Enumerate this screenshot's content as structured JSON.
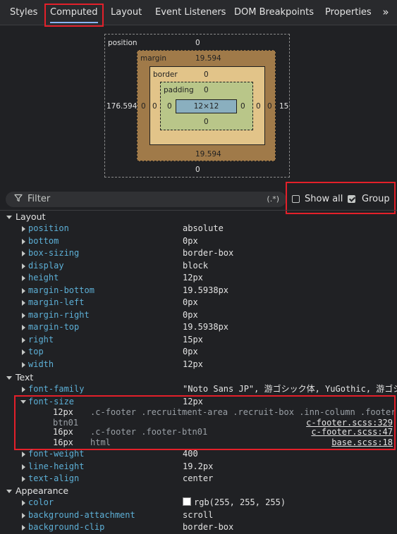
{
  "tabs": [
    {
      "label": "Styles"
    },
    {
      "label": "Computed"
    },
    {
      "label": "Layout"
    },
    {
      "label": "Event Listeners"
    },
    {
      "label": "DOM Breakpoints"
    },
    {
      "label": "Properties"
    }
  ],
  "more_tabs_glyph": "»",
  "box_model": {
    "position_label": "position",
    "position_top": "0",
    "position_left": "176.594",
    "position_right": "15",
    "position_bottom": "0",
    "margin_label": "margin",
    "margin_top": "19.594",
    "margin_left": "0",
    "margin_right": "0",
    "margin_bottom": "19.594",
    "border_label": "border",
    "border_top": "0",
    "border_left": "0",
    "border_right": "0",
    "border_bottom": "",
    "padding_label": "padding",
    "padding_top": "0",
    "padding_left": "0",
    "padding_right": "0",
    "padding_bottom": "0",
    "content": "12×12"
  },
  "filter": {
    "placeholder": "Filter",
    "regex_label": "(.*)"
  },
  "show_all": {
    "label": "Show all",
    "checked": false
  },
  "group": {
    "label": "Group",
    "checked": true
  },
  "groups": {
    "layout": "Layout",
    "text": "Text",
    "appearance": "Appearance"
  },
  "layout_props": [
    {
      "name": "position",
      "value": "absolute"
    },
    {
      "name": "bottom",
      "value": "0px"
    },
    {
      "name": "box-sizing",
      "value": "border-box"
    },
    {
      "name": "display",
      "value": "block"
    },
    {
      "name": "height",
      "value": "12px"
    },
    {
      "name": "margin-bottom",
      "value": "19.5938px"
    },
    {
      "name": "margin-left",
      "value": "0px"
    },
    {
      "name": "margin-right",
      "value": "0px"
    },
    {
      "name": "margin-top",
      "value": "19.5938px"
    },
    {
      "name": "right",
      "value": "15px"
    },
    {
      "name": "top",
      "value": "0px"
    },
    {
      "name": "width",
      "value": "12px"
    }
  ],
  "text_props": {
    "font_family": {
      "name": "font-family",
      "value": "\"Noto Sans JP\", 游ゴシック体, YuGothic, 游ゴシ"
    },
    "font_size": {
      "name": "font-size",
      "value": "12px"
    },
    "font_size_traces": [
      {
        "value": "12px",
        "selector": ".c-footer .recruitment-area .recruit-box .inn-column .footer-",
        "selector_cont": "btn01",
        "source": "c-footer.scss:329"
      },
      {
        "value": "16px",
        "selector": ".c-footer .footer-btn01",
        "source": "c-footer.scss:47"
      },
      {
        "value": "16px",
        "selector": "html",
        "source": "base.scss:18"
      }
    ],
    "font_weight": {
      "name": "font-weight",
      "value": "400"
    },
    "line_height": {
      "name": "line-height",
      "value": "19.2px"
    },
    "text_align": {
      "name": "text-align",
      "value": "center"
    }
  },
  "appearance_props": [
    {
      "name": "color",
      "value": "rgb(255, 255, 255)",
      "swatch": "#ffffff"
    },
    {
      "name": "background-attachment",
      "value": "scroll"
    },
    {
      "name": "background-clip",
      "value": "border-box"
    }
  ],
  "colors": {
    "accent": "#8ab4f8",
    "highlight": "#e3202a",
    "property_name": "#5db0d7"
  }
}
